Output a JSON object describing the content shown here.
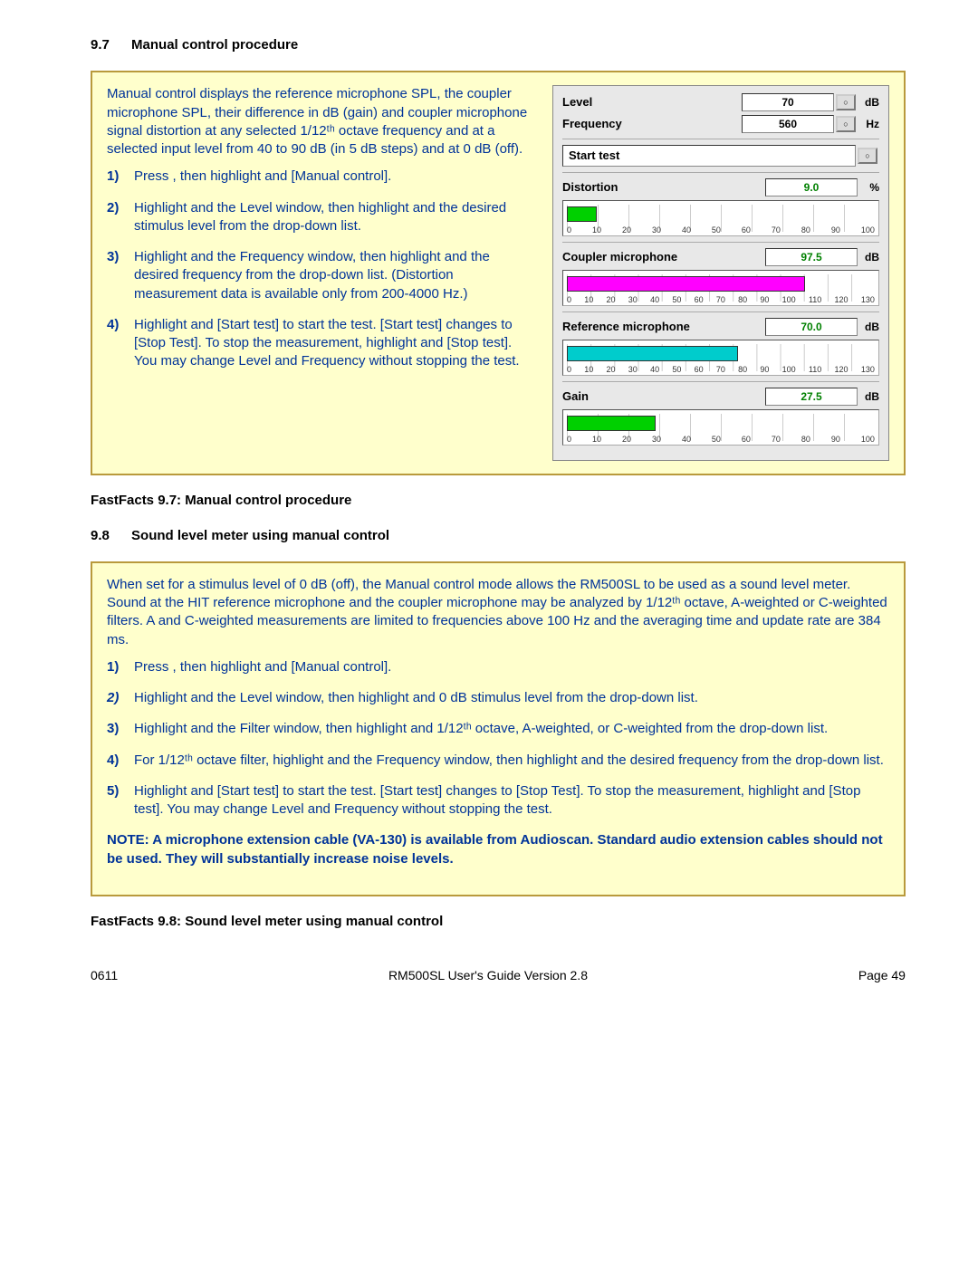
{
  "section1": {
    "number": "9.7",
    "title": "Manual control procedure",
    "intro": "Manual control displays the reference microphone SPL, the coupler microphone SPL, their difference in dB (gain) and coupler microphone signal distortion at any selected 1/12ᵗʰ octave frequency and at a selected input level from 40 to 90 dB (in 5 dB steps) and at 0 dB (off).",
    "steps": [
      "Press <Tests>, then highlight and <PICK> [Manual control].",
      "Highlight and <PICK> the Level window, then highlight and <PICK> the desired stimulus level from the drop-down list.",
      "Highlight and <PICK> the Frequency window, then highlight and <PICK> the desired frequency from the drop-down list. (Distortion measurement data is available only from 200-4000 Hz.)",
      "Highlight and <PICK> [Start test] to start the test. [Start test] changes to [Stop Test]. To stop the measurement, highlight and <PICK> [Stop test]. You may change Level and Frequency without stopping the test."
    ],
    "fastfacts": "FastFacts 9.7: Manual control procedure"
  },
  "screenshot": {
    "level": {
      "label": "Level",
      "value": "70",
      "unit": "dB"
    },
    "frequency": {
      "label": "Frequency",
      "value": "560",
      "unit": "Hz"
    },
    "start": "Start test",
    "distortion": {
      "label": "Distortion",
      "value": "9.0",
      "unit": "%",
      "max": 100,
      "fill": 9,
      "color": "#00d000",
      "ticks": [
        "0",
        "10",
        "20",
        "30",
        "40",
        "50",
        "60",
        "70",
        "80",
        "90",
        "100"
      ]
    },
    "coupler": {
      "label": "Coupler microphone",
      "value": "97.5",
      "unit": "dB",
      "max": 130,
      "fill": 97.5,
      "color": "#ff00ff",
      "ticks": [
        "0",
        "10",
        "20",
        "30",
        "40",
        "50",
        "60",
        "70",
        "80",
        "90",
        "100",
        "110",
        "120",
        "130"
      ]
    },
    "reference": {
      "label": "Reference microphone",
      "value": "70.0",
      "unit": "dB",
      "max": 130,
      "fill": 70,
      "color": "#00cccc",
      "ticks": [
        "0",
        "10",
        "20",
        "30",
        "40",
        "50",
        "60",
        "70",
        "80",
        "90",
        "100",
        "110",
        "120",
        "130"
      ]
    },
    "gain": {
      "label": "Gain",
      "value": "27.5",
      "unit": "dB",
      "max": 100,
      "fill": 27.5,
      "color": "#00d000",
      "ticks": [
        "0",
        "10",
        "20",
        "30",
        "40",
        "50",
        "60",
        "70",
        "80",
        "90",
        "100"
      ]
    }
  },
  "section2": {
    "number": "9.8",
    "title": "Sound level meter using manual control",
    "intro": "When set for a stimulus level of 0 dB (off), the Manual control mode allows the RM500SL to be used as a sound level meter. Sound at the HIT reference microphone and the coupler microphone may be analyzed by 1/12ᵗʰ octave, A-weighted or C-weighted filters. A and C-weighted measurements are limited to frequencies above 100 Hz and the averaging time and update rate are 384 ms.",
    "steps": [
      "Press <Tests>, then highlight and <PICK> [Manual control].",
      "Highlight and <PICK> the Level window, then highlight and <PICK> 0 dB stimulus level from the drop-down list.",
      "Highlight and <PICK> the Filter window, then highlight and <PICK> 1/12ᵗʰ octave, A-weighted, or C-weighted from the drop-down list.",
      "For 1/12ᵗʰ octave filter, highlight and <PICK> the Frequency window, then highlight and <PICK> the desired frequency from the drop-down list.",
      "Highlight and <PICK> [Start test] to start the test. [Start test] changes to [Stop Test]. To stop the measurement, highlight and <PICK> [Stop test]. You may change Level and Frequency without stopping the test."
    ],
    "note": "NOTE: A microphone extension cable (VA-130) is available from Audioscan. Standard audio extension cables should not be used. They will substantially increase noise levels.",
    "fastfacts": "FastFacts 9.8: Sound level meter using manual control"
  },
  "footer": {
    "left": "0611",
    "center": "RM500SL User's Guide Version 2.8",
    "right": "Page 49"
  }
}
